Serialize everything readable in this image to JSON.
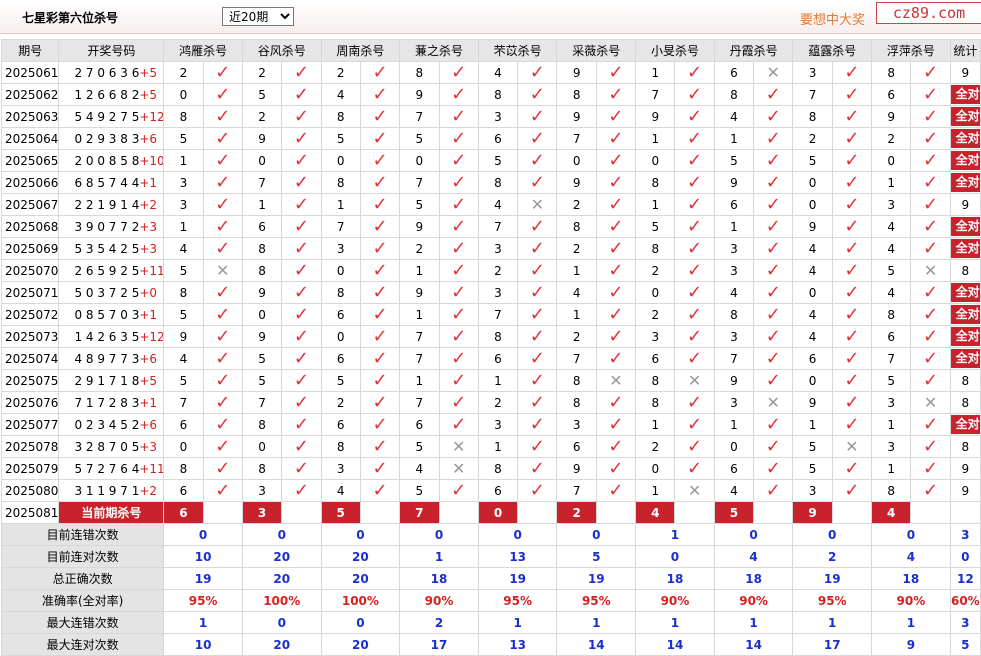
{
  "header": {
    "title": "七星彩第六位杀号",
    "select_value": "近20期",
    "slogan": "要想中大奖",
    "logo_text": "cz89.com"
  },
  "columns": [
    "期号",
    "开奖号码",
    "鸿雁杀号",
    "谷风杀号",
    "周南杀号",
    "蒹之杀号",
    "芣苡杀号",
    "采薇杀号",
    "小旻杀号",
    "丹霞杀号",
    "蕴露杀号",
    "浮萍杀号",
    "统计"
  ],
  "rows": [
    {
      "p": "2025061",
      "n": "2 7 0 6 3 6",
      "b": "+5",
      "k": [
        [
          "2",
          1
        ],
        [
          "2",
          1
        ],
        [
          "2",
          1
        ],
        [
          "8",
          1
        ],
        [
          "4",
          1
        ],
        [
          "9",
          1
        ],
        [
          "1",
          1
        ],
        [
          "6",
          0
        ],
        [
          "3",
          1
        ],
        [
          "8",
          1
        ]
      ],
      "s": "9"
    },
    {
      "p": "2025062",
      "n": "1 2 6 6 8 2",
      "b": "+5",
      "k": [
        [
          "0",
          1
        ],
        [
          "5",
          1
        ],
        [
          "4",
          1
        ],
        [
          "9",
          1
        ],
        [
          "8",
          1
        ],
        [
          "8",
          1
        ],
        [
          "7",
          1
        ],
        [
          "8",
          1
        ],
        [
          "7",
          1
        ],
        [
          "6",
          1
        ]
      ],
      "s": "全对"
    },
    {
      "p": "2025063",
      "n": "5 4 9 2 7 5",
      "b": "+12",
      "k": [
        [
          "8",
          1
        ],
        [
          "2",
          1
        ],
        [
          "8",
          1
        ],
        [
          "7",
          1
        ],
        [
          "3",
          1
        ],
        [
          "9",
          1
        ],
        [
          "9",
          1
        ],
        [
          "4",
          1
        ],
        [
          "8",
          1
        ],
        [
          "9",
          1
        ]
      ],
      "s": "全对"
    },
    {
      "p": "2025064",
      "n": "0 2 9 3 8 3",
      "b": "+6",
      "k": [
        [
          "5",
          1
        ],
        [
          "9",
          1
        ],
        [
          "5",
          1
        ],
        [
          "5",
          1
        ],
        [
          "6",
          1
        ],
        [
          "7",
          1
        ],
        [
          "1",
          1
        ],
        [
          "1",
          1
        ],
        [
          "2",
          1
        ],
        [
          "2",
          1
        ]
      ],
      "s": "全对"
    },
    {
      "p": "2025065",
      "n": "2 0 0 8 5 8",
      "b": "+10",
      "k": [
        [
          "1",
          1
        ],
        [
          "0",
          1
        ],
        [
          "0",
          1
        ],
        [
          "0",
          1
        ],
        [
          "5",
          1
        ],
        [
          "0",
          1
        ],
        [
          "0",
          1
        ],
        [
          "5",
          1
        ],
        [
          "5",
          1
        ],
        [
          "0",
          1
        ]
      ],
      "s": "全对"
    },
    {
      "p": "2025066",
      "n": "6 8 5 7 4 4",
      "b": "+1",
      "k": [
        [
          "3",
          1
        ],
        [
          "7",
          1
        ],
        [
          "8",
          1
        ],
        [
          "7",
          1
        ],
        [
          "8",
          1
        ],
        [
          "9",
          1
        ],
        [
          "8",
          1
        ],
        [
          "9",
          1
        ],
        [
          "0",
          1
        ],
        [
          "1",
          1
        ]
      ],
      "s": "全对"
    },
    {
      "p": "2025067",
      "n": "2 2 1 9 1 4",
      "b": "+2",
      "k": [
        [
          "3",
          1
        ],
        [
          "1",
          1
        ],
        [
          "1",
          1
        ],
        [
          "5",
          1
        ],
        [
          "4",
          0
        ],
        [
          "2",
          1
        ],
        [
          "1",
          1
        ],
        [
          "6",
          1
        ],
        [
          "0",
          1
        ],
        [
          "3",
          1
        ]
      ],
      "s": "9"
    },
    {
      "p": "2025068",
      "n": "3 9 0 7 7 2",
      "b": "+3",
      "k": [
        [
          "1",
          1
        ],
        [
          "6",
          1
        ],
        [
          "7",
          1
        ],
        [
          "9",
          1
        ],
        [
          "7",
          1
        ],
        [
          "8",
          1
        ],
        [
          "5",
          1
        ],
        [
          "1",
          1
        ],
        [
          "9",
          1
        ],
        [
          "4",
          1
        ]
      ],
      "s": "全对"
    },
    {
      "p": "2025069",
      "n": "5 3 5 4 2 5",
      "b": "+3",
      "k": [
        [
          "4",
          1
        ],
        [
          "8",
          1
        ],
        [
          "3",
          1
        ],
        [
          "2",
          1
        ],
        [
          "3",
          1
        ],
        [
          "2",
          1
        ],
        [
          "8",
          1
        ],
        [
          "3",
          1
        ],
        [
          "4",
          1
        ],
        [
          "4",
          1
        ]
      ],
      "s": "全对"
    },
    {
      "p": "2025070",
      "n": "2 6 5 9 2 5",
      "b": "+11",
      "k": [
        [
          "5",
          0
        ],
        [
          "8",
          1
        ],
        [
          "0",
          1
        ],
        [
          "1",
          1
        ],
        [
          "2",
          1
        ],
        [
          "1",
          1
        ],
        [
          "2",
          1
        ],
        [
          "3",
          1
        ],
        [
          "4",
          1
        ],
        [
          "5",
          0
        ]
      ],
      "s": "8"
    },
    {
      "p": "2025071",
      "n": "5 0 3 7 2 5",
      "b": "+0",
      "k": [
        [
          "8",
          1
        ],
        [
          "9",
          1
        ],
        [
          "8",
          1
        ],
        [
          "9",
          1
        ],
        [
          "3",
          1
        ],
        [
          "4",
          1
        ],
        [
          "0",
          1
        ],
        [
          "4",
          1
        ],
        [
          "0",
          1
        ],
        [
          "4",
          1
        ]
      ],
      "s": "全对"
    },
    {
      "p": "2025072",
      "n": "0 8 5 7 0 3",
      "b": "+1",
      "k": [
        [
          "5",
          1
        ],
        [
          "0",
          1
        ],
        [
          "6",
          1
        ],
        [
          "1",
          1
        ],
        [
          "7",
          1
        ],
        [
          "1",
          1
        ],
        [
          "2",
          1
        ],
        [
          "8",
          1
        ],
        [
          "4",
          1
        ],
        [
          "8",
          1
        ]
      ],
      "s": "全对"
    },
    {
      "p": "2025073",
      "n": "1 4 2 6 3 5",
      "b": "+12",
      "k": [
        [
          "9",
          1
        ],
        [
          "9",
          1
        ],
        [
          "0",
          1
        ],
        [
          "7",
          1
        ],
        [
          "8",
          1
        ],
        [
          "2",
          1
        ],
        [
          "3",
          1
        ],
        [
          "3",
          1
        ],
        [
          "4",
          1
        ],
        [
          "6",
          1
        ]
      ],
      "s": "全对"
    },
    {
      "p": "2025074",
      "n": "4 8 9 7 7 3",
      "b": "+6",
      "k": [
        [
          "4",
          1
        ],
        [
          "5",
          1
        ],
        [
          "6",
          1
        ],
        [
          "7",
          1
        ],
        [
          "6",
          1
        ],
        [
          "7",
          1
        ],
        [
          "6",
          1
        ],
        [
          "7",
          1
        ],
        [
          "6",
          1
        ],
        [
          "7",
          1
        ]
      ],
      "s": "全对"
    },
    {
      "p": "2025075",
      "n": "2 9 1 7 1 8",
      "b": "+5",
      "k": [
        [
          "5",
          1
        ],
        [
          "5",
          1
        ],
        [
          "5",
          1
        ],
        [
          "1",
          1
        ],
        [
          "1",
          1
        ],
        [
          "8",
          0
        ],
        [
          "8",
          0
        ],
        [
          "9",
          1
        ],
        [
          "0",
          1
        ],
        [
          "5",
          1
        ]
      ],
      "s": "8"
    },
    {
      "p": "2025076",
      "n": "7 1 7 2 8 3",
      "b": "+1",
      "k": [
        [
          "7",
          1
        ],
        [
          "7",
          1
        ],
        [
          "2",
          1
        ],
        [
          "7",
          1
        ],
        [
          "2",
          1
        ],
        [
          "8",
          1
        ],
        [
          "8",
          1
        ],
        [
          "3",
          0
        ],
        [
          "9",
          1
        ],
        [
          "3",
          0
        ]
      ],
      "s": "8"
    },
    {
      "p": "2025077",
      "n": "0 2 3 4 5 2",
      "b": "+6",
      "k": [
        [
          "6",
          1
        ],
        [
          "8",
          1
        ],
        [
          "6",
          1
        ],
        [
          "6",
          1
        ],
        [
          "3",
          1
        ],
        [
          "3",
          1
        ],
        [
          "1",
          1
        ],
        [
          "1",
          1
        ],
        [
          "1",
          1
        ],
        [
          "1",
          1
        ]
      ],
      "s": "全对"
    },
    {
      "p": "2025078",
      "n": "3 2 8 7 0 5",
      "b": "+3",
      "k": [
        [
          "0",
          1
        ],
        [
          "0",
          1
        ],
        [
          "8",
          1
        ],
        [
          "5",
          0
        ],
        [
          "1",
          1
        ],
        [
          "6",
          1
        ],
        [
          "2",
          1
        ],
        [
          "0",
          1
        ],
        [
          "5",
          0
        ],
        [
          "3",
          1
        ]
      ],
      "s": "8"
    },
    {
      "p": "2025079",
      "n": "5 7 2 7 6 4",
      "b": "+11",
      "k": [
        [
          "8",
          1
        ],
        [
          "8",
          1
        ],
        [
          "3",
          1
        ],
        [
          "4",
          0
        ],
        [
          "8",
          1
        ],
        [
          "9",
          1
        ],
        [
          "0",
          1
        ],
        [
          "6",
          1
        ],
        [
          "5",
          1
        ],
        [
          "1",
          1
        ]
      ],
      "s": "9"
    },
    {
      "p": "2025080",
      "n": "3 1 1 9 7 1",
      "b": "+2",
      "k": [
        [
          "6",
          1
        ],
        [
          "3",
          1
        ],
        [
          "4",
          1
        ],
        [
          "5",
          1
        ],
        [
          "6",
          1
        ],
        [
          "7",
          1
        ],
        [
          "1",
          0
        ],
        [
          "4",
          1
        ],
        [
          "3",
          1
        ],
        [
          "8",
          1
        ]
      ],
      "s": "9"
    }
  ],
  "current": {
    "period": "2025081",
    "label": "当前期杀号",
    "values": [
      "6",
      "3",
      "5",
      "7",
      "0",
      "2",
      "4",
      "5",
      "9",
      "4"
    ]
  },
  "stats": [
    {
      "label": "目前连错次数",
      "values": [
        "0",
        "0",
        "0",
        "0",
        "0",
        "0",
        "1",
        "0",
        "0",
        "0"
      ],
      "total": "3",
      "color": "blue"
    },
    {
      "label": "目前连对次数",
      "values": [
        "10",
        "20",
        "20",
        "1",
        "13",
        "5",
        "0",
        "4",
        "2",
        "4"
      ],
      "total": "0",
      "color": "blue"
    },
    {
      "label": "总正确次数",
      "values": [
        "19",
        "20",
        "20",
        "18",
        "19",
        "19",
        "18",
        "18",
        "19",
        "18"
      ],
      "total": "12",
      "color": "blue"
    },
    {
      "label": "准确率(全对率)",
      "values": [
        "95%",
        "100%",
        "100%",
        "90%",
        "95%",
        "95%",
        "90%",
        "90%",
        "95%",
        "90%"
      ],
      "total": "60%",
      "color": "red"
    },
    {
      "label": "最大连错次数",
      "values": [
        "1",
        "0",
        "0",
        "2",
        "1",
        "1",
        "1",
        "1",
        "1",
        "1"
      ],
      "total": "3",
      "color": "blue"
    },
    {
      "label": "最大连对次数",
      "values": [
        "10",
        "20",
        "20",
        "17",
        "13",
        "14",
        "14",
        "14",
        "17",
        "9"
      ],
      "total": "5",
      "color": "blue"
    }
  ],
  "marks": {
    "ok": "✓",
    "no": "✕"
  },
  "colors": {
    "accent": "#c8232c",
    "check": "#e0303a",
    "stat_blue": "#1a2fd0",
    "stat_red": "#d82020"
  }
}
